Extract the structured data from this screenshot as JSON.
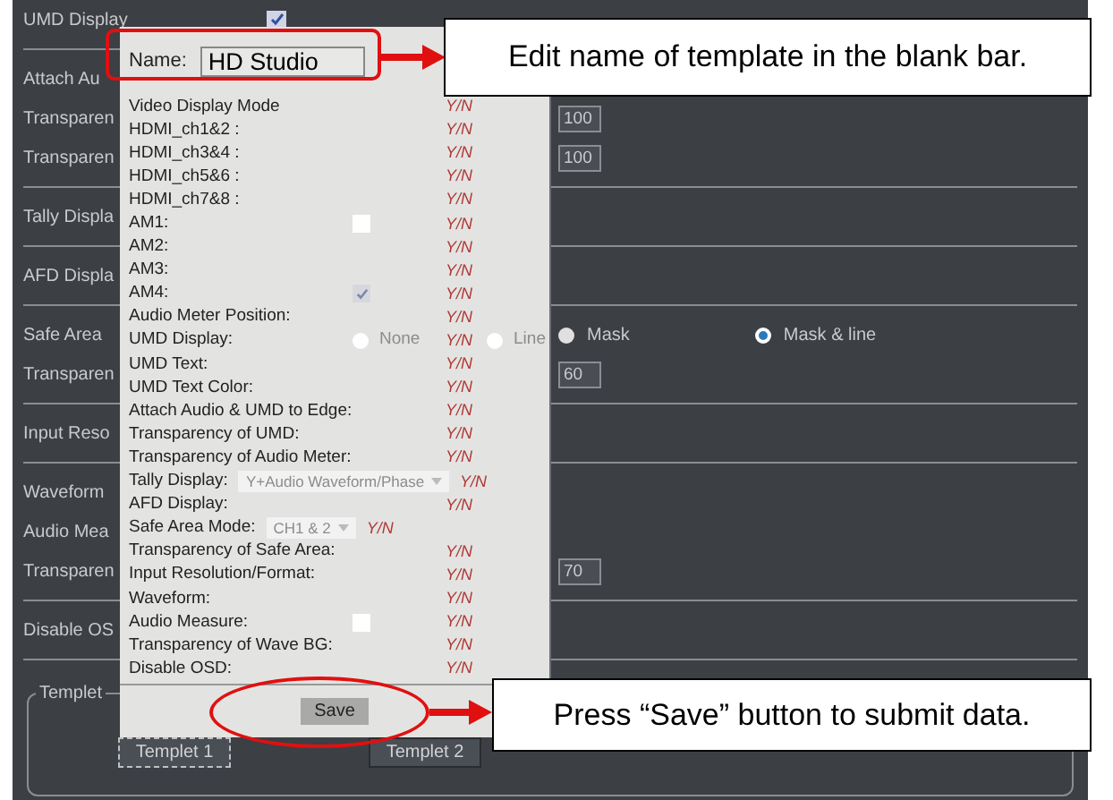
{
  "panel": {
    "sections": [
      [
        {
          "label": "UMD Display",
          "checkbox": {
            "checked": true
          }
        }
      ],
      [
        {
          "label": "Attach Au"
        },
        {
          "label": "Transparen",
          "value": "100"
        },
        {
          "label": "Transparen",
          "value": "100"
        }
      ],
      [
        {
          "label": "Tally Displa"
        }
      ],
      [
        {
          "label": "AFD Displa"
        }
      ],
      [
        {
          "label": "Safe Area",
          "radios": [
            {
              "label": "Mask",
              "selected": false
            },
            {
              "label": "Mask & line",
              "selected": true
            }
          ]
        },
        {
          "label": "Transparen",
          "value": "60"
        }
      ],
      [
        {
          "label": "Input Reso"
        }
      ],
      [
        {
          "label": "Waveform"
        },
        {
          "label": "Audio Mea"
        },
        {
          "label": "Transparen",
          "value": "70"
        }
      ],
      [
        {
          "label": "Disable OS"
        }
      ]
    ],
    "group": {
      "title": "Templet",
      "buttons": [
        {
          "label": "Templet 1",
          "selected": true
        },
        {
          "label": "Templet 2",
          "selected": false
        }
      ]
    }
  },
  "dialog": {
    "name_label": "Name:",
    "name_value": "HD Studio",
    "rows": [
      {
        "label": "Video Display Mode",
        "flag": "Y/N"
      },
      {
        "label": "HDMI_ch1&2 :",
        "flag": "Y/N"
      },
      {
        "label": "HDMI_ch3&4 :",
        "flag": "Y/N"
      },
      {
        "label": "HDMI_ch5&6 :",
        "flag": "Y/N"
      },
      {
        "label": "HDMI_ch7&8 :",
        "flag": "Y/N"
      },
      {
        "label": "AM1:",
        "flag": "Y/N",
        "control": {
          "kind": "checkbox",
          "checked": false
        }
      },
      {
        "label": "AM2:",
        "flag": "Y/N"
      },
      {
        "label": "AM3:",
        "flag": "Y/N"
      },
      {
        "label": "AM4:",
        "flag": "Y/N",
        "control": {
          "kind": "checkbox",
          "checked": true
        }
      },
      {
        "label": "Audio Meter Position:",
        "flag": "Y/N"
      },
      {
        "label": "UMD Display:",
        "flag": "Y/N",
        "control": {
          "kind": "radio",
          "label": "None",
          "selected": false
        },
        "extra": {
          "kind": "radio",
          "label": "Line",
          "selected": false
        }
      },
      {
        "label": "UMD Text:",
        "flag": "Y/N"
      },
      {
        "label": "UMD Text Color:",
        "flag": "Y/N"
      },
      {
        "label": "Attach Audio & UMD to Edge:",
        "flag": "Y/N"
      },
      {
        "label": "Transparency of UMD:",
        "flag": "Y/N"
      },
      {
        "label": "Transparency of Audio Meter:",
        "flag": "Y/N"
      },
      {
        "label": "Tally Display:",
        "flag": "Y/N",
        "extra": {
          "kind": "dropdown",
          "label": "Y+Audio Waveform/Phase"
        }
      },
      {
        "label": "AFD Display:",
        "flag": "Y/N"
      },
      {
        "label": "Safe Area Mode:",
        "flag": "Y/N",
        "extra": {
          "kind": "dropdown",
          "label": "CH1 & 2"
        }
      },
      {
        "label": "Transparency of Safe Area:",
        "flag": "Y/N"
      },
      {
        "label": "Input Resolution/Format:",
        "flag": "Y/N"
      },
      {
        "label": "Waveform:",
        "flag": "Y/N"
      },
      {
        "label": "Audio Measure:",
        "flag": "Y/N",
        "control": {
          "kind": "checkbox",
          "checked": false
        }
      },
      {
        "label": "Transparency of Wave BG:",
        "flag": "Y/N"
      },
      {
        "label": "Disable OSD:",
        "flag": "Y/N"
      }
    ],
    "save": "Save"
  },
  "callouts": [
    "Edit name of template in the blank bar.",
    "Press “Save” button to submit data."
  ]
}
